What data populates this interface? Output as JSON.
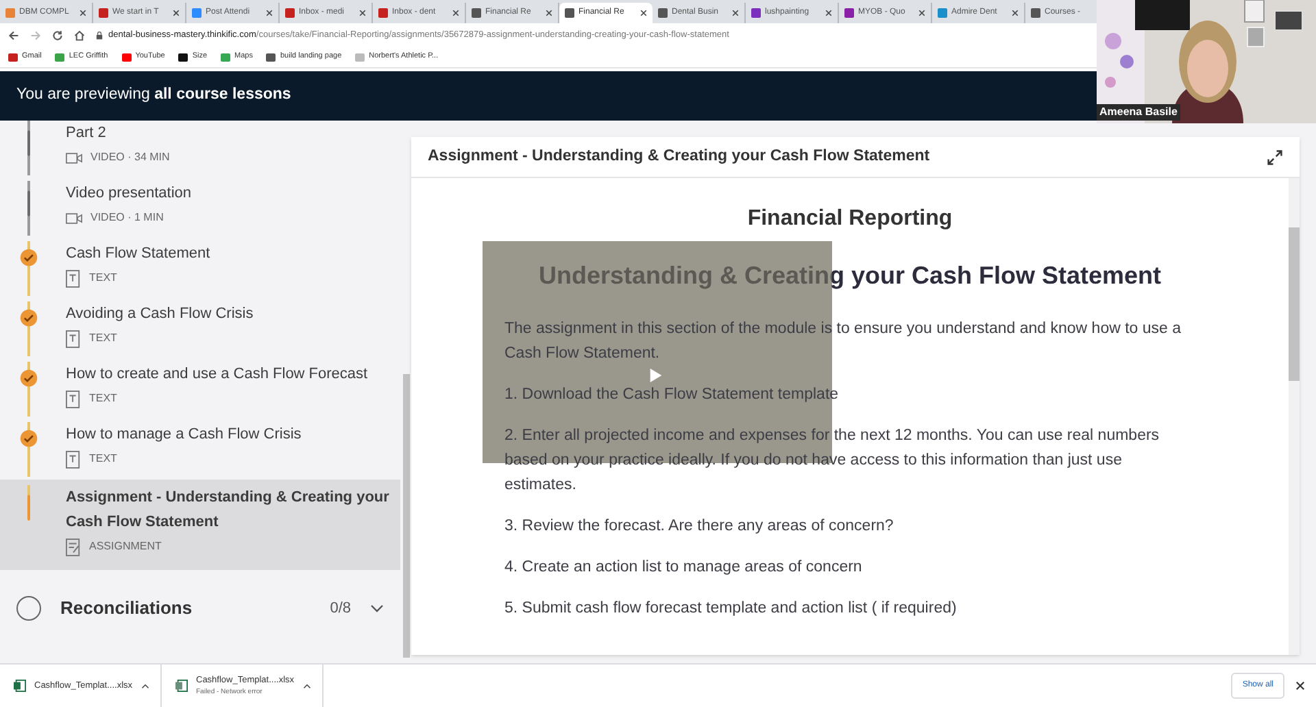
{
  "browser": {
    "tabs": [
      {
        "label": "DBM COMPL",
        "selected": false,
        "color": "#e8833a"
      },
      {
        "label": "We start in T",
        "selected": false,
        "color": "#c5221f"
      },
      {
        "label": "Post Attendi",
        "selected": false,
        "color": "#2d8cff"
      },
      {
        "label": "Inbox - medi",
        "selected": false,
        "color": "#c5221f"
      },
      {
        "label": "Inbox - dent",
        "selected": false,
        "color": "#c5221f"
      },
      {
        "label": "Financial Re",
        "selected": false,
        "color": "#555555"
      },
      {
        "label": "Financial Re",
        "selected": true,
        "color": "#555555"
      },
      {
        "label": "Dental Busin",
        "selected": false,
        "color": "#555555"
      },
      {
        "label": "lushpainting",
        "selected": false,
        "color": "#7b2fbf"
      },
      {
        "label": "MYOB - Quo",
        "selected": false,
        "color": "#8a1fa8"
      },
      {
        "label": "Admire Dent",
        "selected": false,
        "color": "#1a8fc9"
      },
      {
        "label": "Courses -",
        "selected": false,
        "color": "#555555"
      }
    ],
    "url": {
      "host": "dental-business-mastery.thinkific.com",
      "path": "/courses/take/Financial-Reporting/assignments/35672879-assignment-understanding-creating-your-cash-flow-statement"
    },
    "bookmarks": [
      {
        "label": "Gmail",
        "color": "#c5221f"
      },
      {
        "label": "LEC Griffith",
        "color": "#3aa548"
      },
      {
        "label": "YouTube",
        "color": "#ff0000"
      },
      {
        "label": "Size",
        "color": "#111111"
      },
      {
        "label": "Maps",
        "color": "#34a853"
      },
      {
        "label": "build landing page",
        "color": "#555555"
      },
      {
        "label": "Norbert's Athletic P...",
        "color": "#bbbbbb"
      }
    ]
  },
  "banner": {
    "prefix": "You are previewing",
    "bold": "all course lessons"
  },
  "webcam": {
    "name": "Ameena Basile"
  },
  "sidebar": {
    "lessons": [
      {
        "title": "Part 2",
        "kind": "video",
        "meta": "VIDEO · 34 MIN",
        "completed": false,
        "selected": false
      },
      {
        "title": "Video presentation",
        "kind": "video",
        "meta": "VIDEO · 1 MIN",
        "completed": false,
        "selected": false
      },
      {
        "title": "Cash Flow Statement",
        "kind": "text",
        "meta": "TEXT",
        "completed": true,
        "selected": false
      },
      {
        "title": "Avoiding a Cash Flow Crisis",
        "kind": "text",
        "meta": "TEXT",
        "completed": true,
        "selected": false
      },
      {
        "title": "How to create and use a Cash Flow Forecast",
        "kind": "text",
        "meta": "TEXT",
        "completed": true,
        "selected": false
      },
      {
        "title": "How to manage a Cash Flow Crisis",
        "kind": "text",
        "meta": "TEXT",
        "completed": true,
        "selected": false
      },
      {
        "title": "Assignment - Understanding & Creating your Cash Flow Statement",
        "kind": "assignment",
        "meta": "ASSIGNMENT",
        "completed": false,
        "selected": true
      }
    ],
    "chapter": {
      "title": "Reconciliations",
      "count": "0/8",
      "expanded": false
    }
  },
  "content": {
    "header": "Assignment - Understanding & Creating your Cash Flow Statement",
    "title": "Financial Reporting",
    "heading": "Understanding & Creating your Cash Flow Statement",
    "paragraphs": [
      "The assignment in this section of the module is to ensure you understand and know how to use a Cash Flow Statement.",
      "1. Download the Cash Flow Statement template",
      "2. Enter all projected income and expenses for the next 12 months. You can use real numbers based on your practice ideally. If you do not have access to this information than just use estimates.",
      "3. Review the forecast. Are there any areas of concern?",
      "4. Create an action list to manage areas of concern",
      "5. Submit cash flow forecast template and action list ( if required)"
    ]
  },
  "downloads": {
    "items": [
      {
        "name": "Cashflow_Templat....xlsx",
        "failed": false
      },
      {
        "name": "Cashflow_Templat....xlsx",
        "failed": true,
        "status": "Failed - Network error"
      }
    ],
    "show_all": "Show all"
  }
}
